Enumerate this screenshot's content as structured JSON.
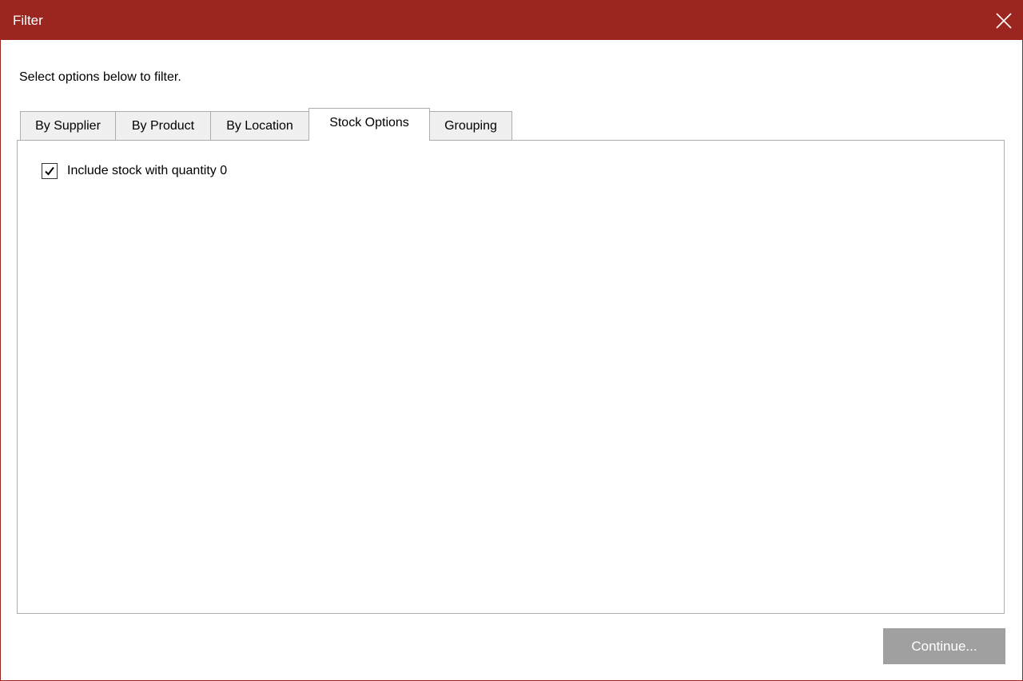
{
  "window": {
    "title": "Filter"
  },
  "instructions": "Select options below to filter.",
  "tabs": [
    {
      "label": "By Supplier",
      "active": false
    },
    {
      "label": "By Product",
      "active": false
    },
    {
      "label": "By Location",
      "active": false
    },
    {
      "label": "Stock Options",
      "active": true
    },
    {
      "label": "Grouping",
      "active": false
    }
  ],
  "stock_options": {
    "include_zero_qty": {
      "label": "Include stock with quantity 0",
      "checked": true
    }
  },
  "footer": {
    "continue_label": "Continue..."
  },
  "colors": {
    "titlebar": "#9b2620",
    "button_disabled": "#a0a0a0"
  },
  "icons": {
    "close": "close-icon",
    "check": "checkmark-icon"
  }
}
